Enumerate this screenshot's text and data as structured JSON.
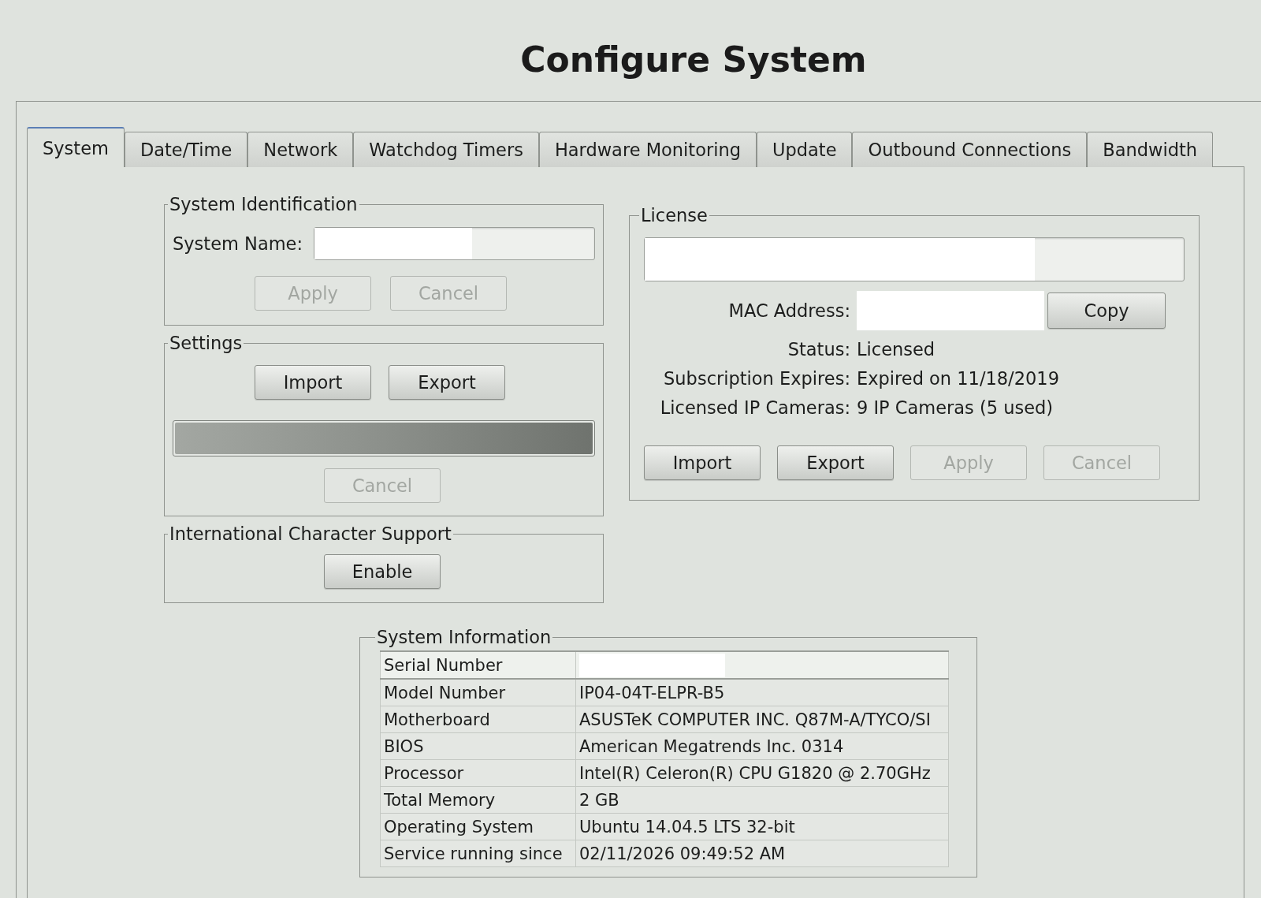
{
  "window": {
    "title": "Configure System"
  },
  "tabs": [
    {
      "label": "System",
      "selected": true
    },
    {
      "label": "Date/Time",
      "selected": false
    },
    {
      "label": "Network",
      "selected": false
    },
    {
      "label": "Watchdog Timers",
      "selected": false
    },
    {
      "label": "Hardware Monitoring",
      "selected": false
    },
    {
      "label": "Update",
      "selected": false
    },
    {
      "label": "Outbound Connections",
      "selected": false
    },
    {
      "label": "Bandwidth",
      "selected": false
    }
  ],
  "system_identification": {
    "title": "System Identification",
    "system_name": {
      "label": "System Name:",
      "redacted": true
    },
    "buttons": [
      {
        "label": "Apply",
        "disabled": true
      },
      {
        "label": "Cancel",
        "disabled": true
      }
    ]
  },
  "settings": {
    "title": "Settings",
    "buttons": [
      {
        "label": "Import",
        "disabled": false
      },
      {
        "label": "Export",
        "disabled": false
      }
    ],
    "progress": {
      "level": 1
    },
    "cancel": {
      "label": "Cancel",
      "disabled": true
    }
  },
  "international_character_support": {
    "title": "International Character Support",
    "button": {
      "label": "Enable",
      "disabled": false
    }
  },
  "license": {
    "title": "License",
    "key_field": {
      "redacted": true
    },
    "mac_address": {
      "label": "MAC Address:",
      "redacted": true
    },
    "copy_button": {
      "label": "Copy",
      "disabled": false
    },
    "info": [
      {
        "label": "Status:",
        "value": "Licensed"
      },
      {
        "label": "Subscription Expires:",
        "value": "Expired on 11/18/2019"
      },
      {
        "label": "Licensed IP Cameras:",
        "value": "9 IP Cameras (5 used)"
      }
    ],
    "buttons": [
      {
        "label": "Import",
        "disabled": false
      },
      {
        "label": "Export",
        "disabled": false
      },
      {
        "label": "Apply",
        "disabled": true
      },
      {
        "label": "Cancel",
        "disabled": true
      }
    ]
  },
  "system_information": {
    "title": "System Information",
    "rows": [
      {
        "label": "Serial Number",
        "redacted": true,
        "selected": true
      },
      {
        "label": "Model Number",
        "value": "IP04-04T-ELPR-B5",
        "selected": false
      },
      {
        "label": "Motherboard",
        "value": "ASUSTeK COMPUTER INC. Q87M-A/TYCO/SI",
        "selected": false
      },
      {
        "label": "BIOS",
        "value": "American Megatrends Inc. 0314",
        "selected": false
      },
      {
        "label": "Processor",
        "value": "Intel(R) Celeron(R) CPU G1820 @ 2.70GHz",
        "selected": false
      },
      {
        "label": "Total Memory",
        "value": "2 GB",
        "selected": false
      },
      {
        "label": "Operating System",
        "value": "Ubuntu 14.04.5 LTS 32-bit",
        "selected": false
      },
      {
        "label": "Service running since",
        "value": "02/11/2026 09:49:52 AM",
        "selected": false
      }
    ]
  }
}
